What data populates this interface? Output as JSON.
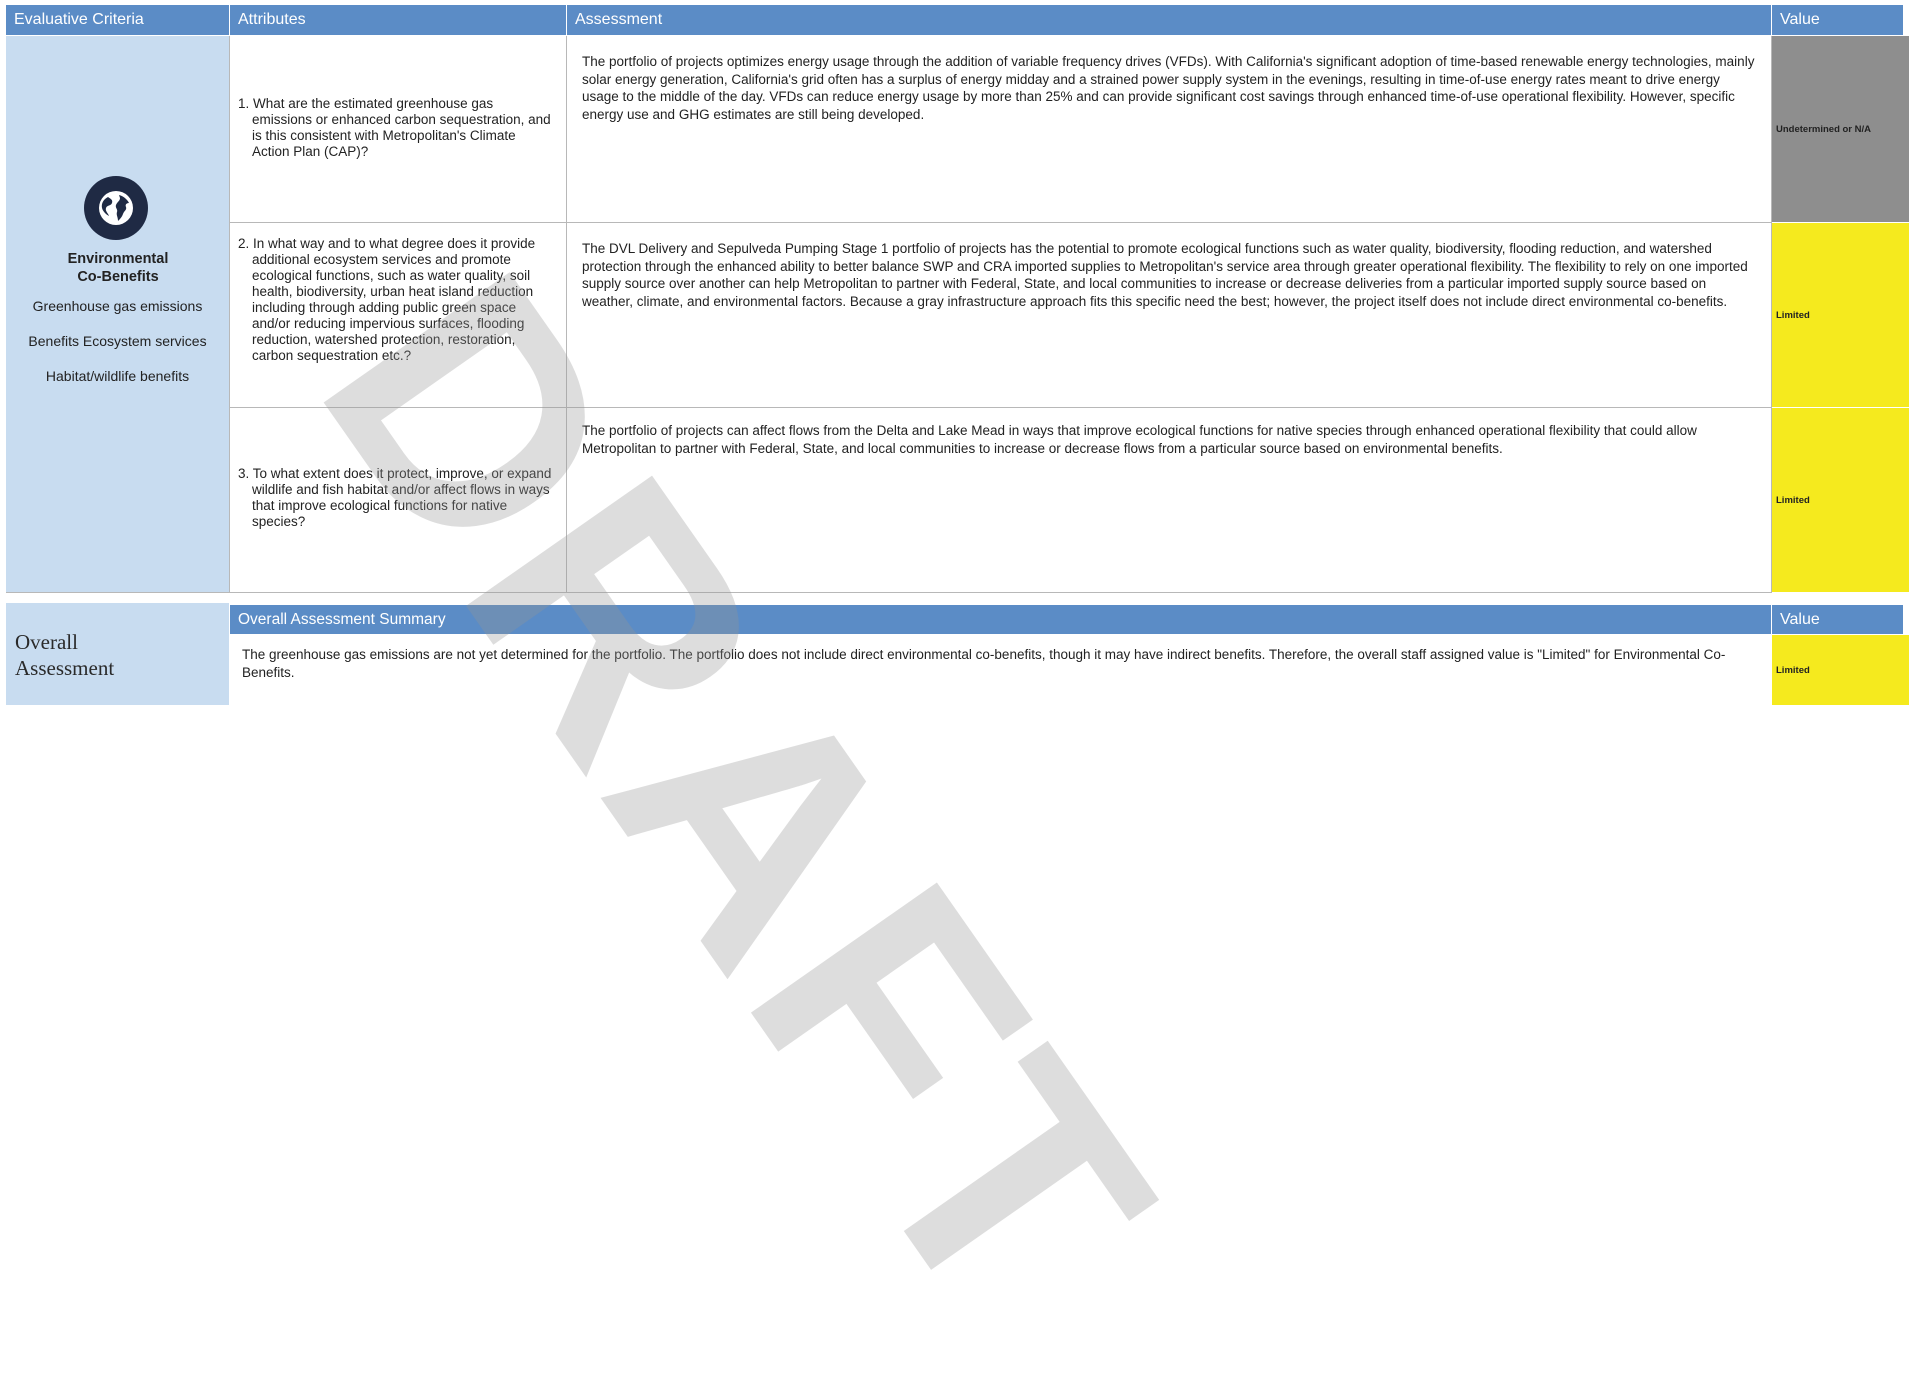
{
  "header": {
    "criteria": "Evaluative Criteria",
    "attributes": "Attributes",
    "assessment": "Assessment",
    "value": "Value"
  },
  "criteria": {
    "icon": "globe-icon",
    "title": "Environmental Co-Benefits",
    "items": [
      "Greenhouse gas emissions",
      "Benefits Ecosystem services",
      "Habitat/wildlife benefits"
    ]
  },
  "rows": [
    {
      "attribute": "1. What are the estimated greenhouse gas emissions or enhanced carbon sequestration, and is this consistent with Metropolitan's Climate Action Plan (CAP)?",
      "assessment": "The portfolio of projects optimizes energy usage through the addition of variable frequency drives (VFDs). With California's significant adoption of time-based renewable energy technologies, mainly solar energy generation, California's grid often has a surplus of energy midday and a strained power supply system in the evenings, resulting in time-of-use energy rates meant to drive energy usage to the middle of the day. VFDs can reduce energy usage by more than 25% and can provide significant cost savings through enhanced time-of-use operational flexibility. However, specific energy use and GHG estimates are still being developed.",
      "value": "Undetermined or N/A",
      "color": "#8e8e8e"
    },
    {
      "attribute": "2.  In what way and to what degree does it provide additional ecosystem services and promote ecological functions, such as water quality, soil health, biodiversity, urban heat island reduction including through adding public green space and/or reducing impervious surfaces, flooding reduction, watershed protection, restoration, carbon sequestration etc.?",
      "assessment": "The DVL Delivery and Sepulveda Pumping Stage 1 portfolio of projects has the potential to promote ecological functions such as water quality, biodiversity, flooding reduction, and watershed protection through the enhanced ability to better balance SWP and CRA imported supplies to Metropolitan's service area through greater operational flexibility. The flexibility to rely on one imported supply source over another can help Metropolitan to partner with Federal, State, and local communities to increase or decrease deliveries from a particular imported supply source based on weather, climate, and environmental factors. Because a gray infrastructure approach fits this specific need the best; however, the project itself does not include direct environmental co-benefits.",
      "value": "Limited",
      "color": "#f5ea1e"
    },
    {
      "attribute": "3. To what extent does it protect, improve, or expand wildlife and fish habitat and/or affect flows in ways that improve ecological functions for native species?",
      "assessment": "The portfolio of projects can affect flows from the Delta and Lake Mead in ways that improve ecological functions for native species through enhanced operational flexibility that could allow Metropolitan to partner with Federal, State, and local communities to increase or decrease flows from a particular source based on environmental benefits.",
      "value": "Limited",
      "color": "#f5ea1e"
    }
  ],
  "overall": {
    "label": "Overall Assessment",
    "summary_header": "Overall Assessment Summary",
    "value_header": "Value",
    "summary": "The greenhouse gas emissions are not yet determined for the portfolio. The portfolio does not include direct environmental co-benefits, though it may have indirect benefits. Therefore, the overall staff assigned value is \"Limited\" for Environmental Co-Benefits.",
    "value": "Limited",
    "color": "#f5ea1e"
  },
  "watermark": "DRAFT"
}
